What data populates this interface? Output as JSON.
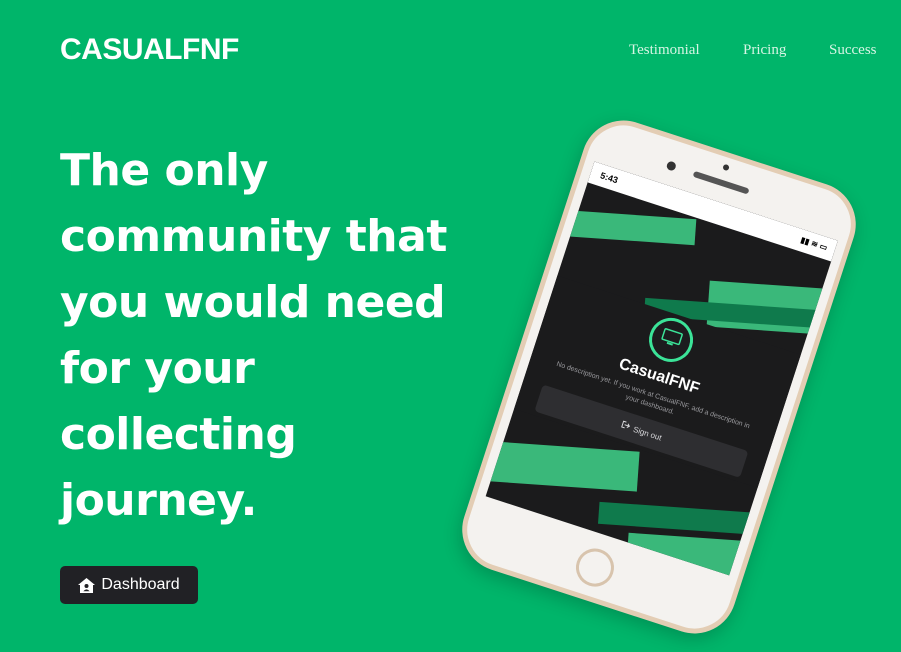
{
  "brand": {
    "name": "CASUALFNF"
  },
  "nav": {
    "items": [
      {
        "label": "Testimonial"
      },
      {
        "label": "Pricing"
      },
      {
        "label": "Success"
      }
    ]
  },
  "hero": {
    "headline": "The only community that you would need for your collecting journey.",
    "button_label": "Dashboard",
    "button_icon": "house-user-icon"
  },
  "phone_screen": {
    "time": "5:43",
    "status_icons": "▮▮ ≋ ▭",
    "app_name": "CasualFNF",
    "description": "No description yet. If you work at CasualFNF, add a description in your dashboard.",
    "signout_label": "Sign out",
    "signout_icon": "sign-out-icon"
  },
  "colors": {
    "background": "#00b56a",
    "button": "#212125",
    "accent": "#3be398"
  }
}
